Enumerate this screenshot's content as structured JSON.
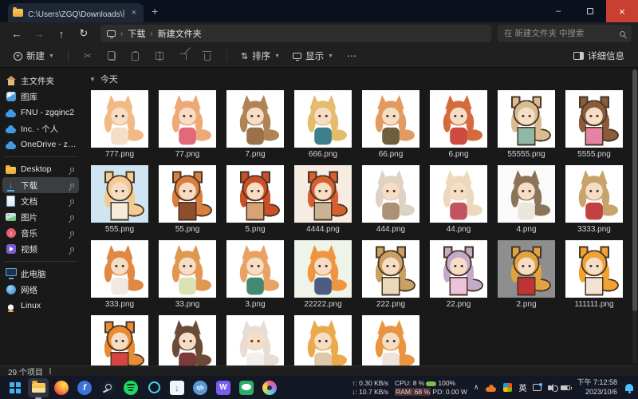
{
  "window": {
    "tab_title": "C:\\Users\\ZGQ\\Downloads\\新建"
  },
  "nav": {
    "breadcrumb": [
      "下载",
      "新建文件夹"
    ],
    "search_placeholder": "在 新建文件夹 中搜索"
  },
  "toolbar": {
    "new_label": "新建",
    "sort_label": "排序",
    "view_label": "显示",
    "details_label": "详细信息"
  },
  "sidebar": {
    "top": [
      {
        "label": "主文件夹",
        "icon": "home"
      },
      {
        "label": "图库",
        "icon": "gallery"
      },
      {
        "label": "FNU - zgqinc2",
        "icon": "cloud"
      },
      {
        "label": "Inc. - 个人",
        "icon": "cloud"
      },
      {
        "label": "OneDrive - zgqinc",
        "icon": "cloud"
      }
    ],
    "pinned": [
      {
        "label": "Desktop",
        "icon": "folder",
        "pin": true
      },
      {
        "label": "下载",
        "icon": "download",
        "pin": true,
        "selected": true
      },
      {
        "label": "文档",
        "icon": "doc",
        "pin": true
      },
      {
        "label": "图片",
        "icon": "pic",
        "pin": true
      },
      {
        "label": "音乐",
        "icon": "music",
        "pin": true
      },
      {
        "label": "视频",
        "icon": "video",
        "pin": true
      }
    ],
    "bottom": [
      {
        "label": "此电脑",
        "icon": "pc"
      },
      {
        "label": "网络",
        "icon": "net"
      },
      {
        "label": "Linux",
        "icon": "linux"
      }
    ]
  },
  "content": {
    "group_label": "今天",
    "files": [
      {
        "name": "777.png",
        "bg": "#ffffff",
        "hair": "#f1b984",
        "accent": "#f6ddc8",
        "pixel": false
      },
      {
        "name": "77.png",
        "bg": "#ffffff",
        "hair": "#efa878",
        "accent": "#e06a78",
        "pixel": false
      },
      {
        "name": "7.png",
        "bg": "#ffffff",
        "hair": "#b08357",
        "accent": "#9a7148",
        "pixel": false
      },
      {
        "name": "666.png",
        "bg": "#ffffff",
        "hair": "#e6bc6b",
        "accent": "#3e7f8e",
        "pixel": false
      },
      {
        "name": "66.png",
        "bg": "#ffffff",
        "hair": "#e39a60",
        "accent": "#6f5e40",
        "pixel": false
      },
      {
        "name": "6.png",
        "bg": "#ffffff",
        "hair": "#d56a3c",
        "accent": "#cf4b42",
        "pixel": false
      },
      {
        "name": "55555.png",
        "bg": "#ffffff",
        "hair": "#d9bd90",
        "accent": "#8fb8a6",
        "pixel": true
      },
      {
        "name": "5555.png",
        "bg": "#ffffff",
        "hair": "#8a5c3c",
        "accent": "#e583a3",
        "pixel": true
      },
      {
        "name": "555.png",
        "bg": "#cfe6f2",
        "hair": "#f2cb93",
        "accent": "#f6ead9",
        "pixel": true
      },
      {
        "name": "55.png",
        "bg": "#ffffff",
        "hair": "#d8803f",
        "accent": "#8d4e2d",
        "pixel": true
      },
      {
        "name": "5.png",
        "bg": "#ffffff",
        "hair": "#cb5026",
        "accent": "#d9a273",
        "pixel": true
      },
      {
        "name": "4444.png",
        "bg": "#f6ece2",
        "hair": "#d8602f",
        "accent": "#c9b392",
        "pixel": true
      },
      {
        "name": "444.png",
        "bg": "#ffffff",
        "hair": "#ded2c3",
        "accent": "#ab9176",
        "pixel": false
      },
      {
        "name": "44.png",
        "bg": "#ffffff",
        "hair": "#ecd9bb",
        "accent": "#c25360",
        "pixel": false
      },
      {
        "name": "4.png",
        "bg": "#fafafa",
        "hair": "#8c7257",
        "accent": "#eae6dc",
        "pixel": false
      },
      {
        "name": "3333.png",
        "bg": "#ffffff",
        "hair": "#c9a36c",
        "accent": "#c24242",
        "pixel": false
      },
      {
        "name": "333.png",
        "bg": "#ffffff",
        "hair": "#e18842",
        "accent": "#efe9e1",
        "pixel": false
      },
      {
        "name": "33.png",
        "bg": "#ffffff",
        "hair": "#e09851",
        "accent": "#dbe2b4",
        "pixel": false
      },
      {
        "name": "3.png",
        "bg": "#ffffff",
        "hair": "#e9a263",
        "accent": "#438a72",
        "pixel": false
      },
      {
        "name": "22222.png",
        "bg": "#eef4e9",
        "hair": "#f0953f",
        "accent": "#4d5d82",
        "pixel": false
      },
      {
        "name": "222.png",
        "bg": "#ffffff",
        "hair": "#c9a263",
        "accent": "#ead9ba",
        "pixel": true
      },
      {
        "name": "22.png",
        "bg": "#ffffff",
        "hair": "#c2aacb",
        "accent": "#ecc3da",
        "pixel": true
      },
      {
        "name": "2.png",
        "bg": "#8e8e8e",
        "hair": "#e1a342",
        "accent": "#bf3433",
        "pixel": true
      },
      {
        "name": "111111.png",
        "bg": "#ffffff",
        "hair": "#f0a233",
        "accent": "#f2e3d3",
        "pixel": true
      },
      {
        "name": "",
        "bg": "#ffffff",
        "hair": "#e78c33",
        "accent": "#d84444",
        "pixel": true
      },
      {
        "name": "",
        "bg": "#ffffff",
        "hair": "#6b4b37",
        "accent": "#7d3a3a",
        "pixel": false
      },
      {
        "name": "",
        "bg": "#ffffff",
        "hair": "#e9dcd2",
        "accent": "#f1f0ee",
        "pixel": false
      },
      {
        "name": "",
        "bg": "#ffffff",
        "hair": "#eaa94a",
        "accent": "#dcc9a8",
        "pixel": false
      },
      {
        "name": "",
        "bg": "#ffffff",
        "hair": "#ea9440",
        "accent": "#ece4da",
        "pixel": false
      }
    ]
  },
  "statusbar": {
    "items_count": "29 个项目"
  },
  "taskbar": {
    "apps": [
      {
        "id": "start"
      },
      {
        "id": "explorer",
        "active": true
      },
      {
        "id": "firefox"
      },
      {
        "id": "files",
        "glyph": "f"
      },
      {
        "id": "steam"
      },
      {
        "id": "spotify"
      },
      {
        "id": "quark"
      },
      {
        "id": "downloader",
        "glyph": "↓"
      },
      {
        "id": "qbittorrent",
        "glyph": "qb"
      },
      {
        "id": "watt",
        "glyph": "W"
      },
      {
        "id": "wechat"
      },
      {
        "id": "paint"
      }
    ],
    "tray": {
      "up": "↑: 0.30 KB/s",
      "down": "↓: 10.7 KB/s",
      "cpu": "CPU: 8 %",
      "battery": "100%",
      "ram": "RAM: 68 %",
      "power": "PD: 0.00 W",
      "ime": "英",
      "time": "下午 7:12:58",
      "date": "2023/10/6"
    }
  },
  "colors": {
    "accent_blue": "#4cc2ff",
    "close_button": "#c84031",
    "selection": "#3a3d41",
    "titlebar": "#0b101d"
  }
}
